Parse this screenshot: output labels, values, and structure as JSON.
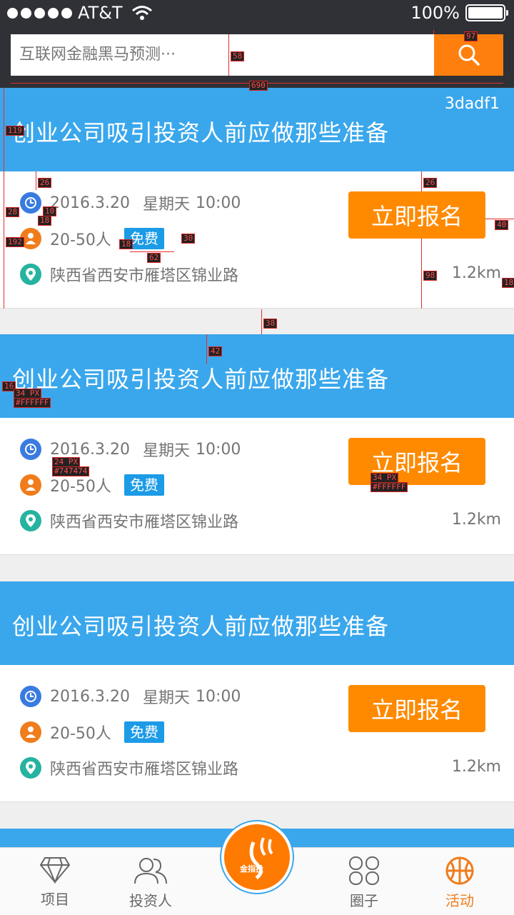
{
  "status_bar": {
    "carrier": "AT&T",
    "battery": "100%"
  },
  "search": {
    "placeholder": "互联网金融黑马预测···"
  },
  "events": [
    {
      "title": "创业公司吸引投资人前应做那些准备",
      "code": "3dadf1",
      "date": "2016.3.20",
      "weekday": "星期天",
      "time": "10:00",
      "people": "20-50人",
      "fee": "免费",
      "address": "陕西省西安市雁塔区锦业路",
      "distance": "1.2km",
      "signup": "立即报名"
    },
    {
      "title": "创业公司吸引投资人前应做那些准备",
      "code": "",
      "date": "2016.3.20",
      "weekday": "星期天",
      "time": "10:00",
      "people": "20-50人",
      "fee": "免费",
      "address": "陕西省西安市雁塔区锦业路",
      "distance": "1.2km",
      "signup": "立即报名"
    },
    {
      "title": "创业公司吸引投资人前应做那些准备",
      "code": "",
      "date": "2016.3.20",
      "weekday": "星期天",
      "time": "10:00",
      "people": "20-50人",
      "fee": "免费",
      "address": "陕西省西安市雁塔区锦业路",
      "distance": "1.2km",
      "signup": "立即报名"
    }
  ],
  "annotations": {
    "a97": "97",
    "a58": "58",
    "a690": "690",
    "a119": "119",
    "a26": "26",
    "a28": "28",
    "a10": "10",
    "a18": "18",
    "a192": "192",
    "a18b": "18",
    "a30": "30",
    "a62": "62",
    "a26b": "26",
    "a40": "40",
    "a98": "98",
    "a18c": "18",
    "a38": "38",
    "a42": "42",
    "a16": "16",
    "spec_title_1": "34 PX",
    "spec_title_2": "#FFFFFF",
    "spec_text_1": "24 PX",
    "spec_text_2": "#747474",
    "spec_btn_1": "34 PX",
    "spec_btn_2": "#FFFFFF"
  },
  "tabbar": {
    "items": [
      {
        "label": "项目",
        "icon": "diamond-icon"
      },
      {
        "label": "投资人",
        "icon": "people-icon"
      },
      {
        "label": "圈子",
        "icon": "clover-icon"
      },
      {
        "label": "活动",
        "icon": "basketball-icon"
      }
    ],
    "center_label": "金指投"
  },
  "colors": {
    "accent": "#ff8a00",
    "banner": "#3aa7ec",
    "text_gray": "#747474"
  }
}
